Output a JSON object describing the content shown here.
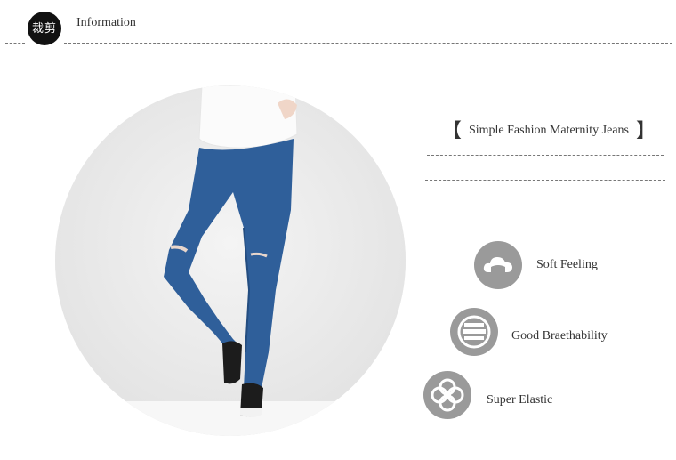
{
  "header": {
    "badge_text": "裁剪",
    "title": "Information"
  },
  "product": {
    "title": "Simple Fashion Maternity Jeans",
    "bracket_open": "【",
    "bracket_close": "】"
  },
  "features": [
    {
      "label": "Soft Feeling",
      "icon": "cloud-icon"
    },
    {
      "label": "Good Braethability",
      "icon": "breathable-vent-icon"
    },
    {
      "label": "Super Elastic",
      "icon": "flower-icon"
    }
  ],
  "colors": {
    "icon_bg": "#9a9a9a",
    "denim": "#2f5f9a",
    "badge_bg": "#111111"
  }
}
